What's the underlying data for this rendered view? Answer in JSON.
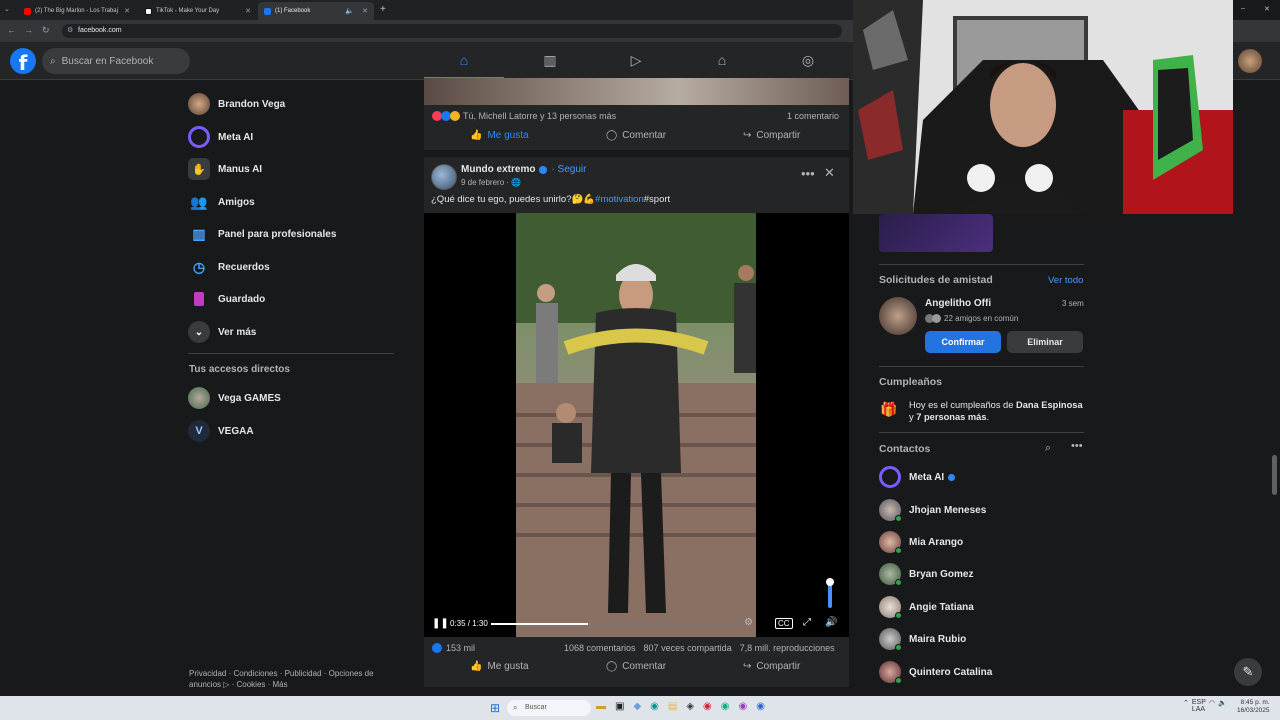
{
  "browser": {
    "tabs": [
      {
        "title": "(2) The Big Marlon - Los Trabaj",
        "favicon_color": "#ff0000"
      },
      {
        "title": "TikTok - Make Your Day",
        "favicon_color": "#111111"
      },
      {
        "title": "(1) Facebook",
        "favicon_color": "#1877f2"
      }
    ],
    "url": "facebook.com"
  },
  "header": {
    "logo": "f",
    "search_placeholder": "Buscar en Facebook",
    "nav_icons": [
      "home-icon",
      "dashboard-icon",
      "video-icon",
      "marketplace-icon",
      "groups-icon"
    ]
  },
  "sidebar": {
    "items": [
      {
        "label": "Brandon Vega",
        "icon": "avatar"
      },
      {
        "label": "Meta AI",
        "icon": "meta-ai-icon"
      },
      {
        "label": "Manus AI",
        "icon": "manus-icon"
      },
      {
        "label": "Amigos",
        "icon": "friends-icon"
      },
      {
        "label": "Panel para profesionales",
        "icon": "dashboard-icon"
      },
      {
        "label": "Recuerdos",
        "icon": "memories-icon"
      },
      {
        "label": "Guardado",
        "icon": "saved-icon"
      },
      {
        "label": "Ver más",
        "icon": "chevron-down-icon"
      }
    ],
    "shortcuts_title": "Tus accesos directos",
    "shortcuts": [
      {
        "label": "Vega GAMES"
      },
      {
        "label": "VEGAA"
      }
    ],
    "footer": "Privacidad · Condiciones · Publicidad · Opciones de anuncios ▷ · Cookies · Más"
  },
  "post1": {
    "reactions_text": "Tú, Michell Latorre y 13 personas más",
    "comments_text": "1 comentario",
    "like_label": "Me gusta",
    "comment_label": "Comentar",
    "share_label": "Compartir"
  },
  "post2": {
    "author": "Mundo extremo",
    "follow": "· Seguir",
    "date": "9 de febrero ·",
    "caption_prefix": "¿Qué dice tu ego, puedes unirlo?",
    "caption_emoji": "🤔💪",
    "caption_hashtag": "#motivation",
    "caption_suffix": "#sport",
    "video_time": "0:35 / 1:30",
    "video_progress": 0.39,
    "reactions_count": "153 mil",
    "comments": "1068 comentarios",
    "shares": "807 veces compartida",
    "views": "7,8 mill. reproducciones",
    "like_label": "Me gusta",
    "comment_label": "Comentar",
    "share_label": "Compartir"
  },
  "right": {
    "friend_requests_title": "Solicitudes de amistad",
    "see_all": "Ver todo",
    "request": {
      "name": "Angelitho Offi",
      "time": "3 sem",
      "mutual": "22 amigos en común",
      "confirm": "Confirmar",
      "delete": "Eliminar"
    },
    "birthdays_title": "Cumpleaños",
    "birthday_prefix": "Hoy es el cumpleaños de ",
    "birthday_name": "Dana Espinosa",
    "birthday_mid": " y ",
    "birthday_others": "7 personas más",
    "birthday_end": ".",
    "contacts_title": "Contactos",
    "contacts": [
      {
        "name": "Meta AI"
      },
      {
        "name": "Jhojan Meneses"
      },
      {
        "name": "Mia Arango"
      },
      {
        "name": "Bryan Gomez"
      },
      {
        "name": "Angie Tatiana"
      },
      {
        "name": "Maira Rubio"
      },
      {
        "name": "Quintero Catalina"
      }
    ]
  },
  "taskbar": {
    "search_placeholder": "Buscar",
    "lang": "ESP\nLAA",
    "time": "8:45 p. m.",
    "date": "16/03/2025"
  },
  "colors": {
    "accent": "#2374e1",
    "fb_blue": "#1877f2",
    "bg": "#18191a",
    "card": "#242526",
    "online": "#31a24c"
  }
}
